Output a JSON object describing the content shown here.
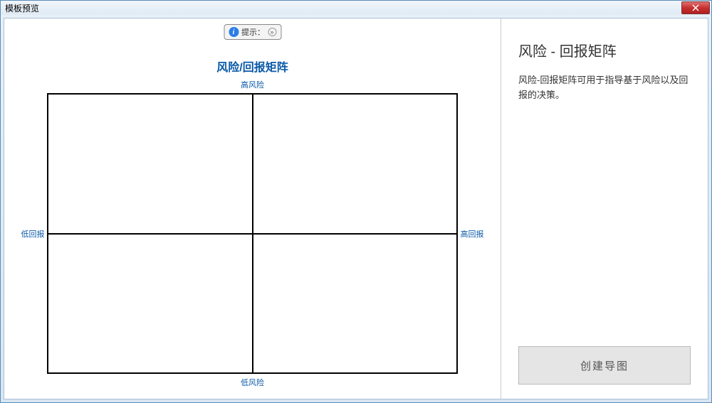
{
  "window": {
    "title": "模板预览"
  },
  "hint": {
    "label": "提示："
  },
  "matrix": {
    "title": "风险/回报矩阵",
    "top": "高风险",
    "bottom": "低风险",
    "left": "低回报",
    "right": "高回报"
  },
  "sidebar": {
    "title": "风险 - 回报矩阵",
    "description": "风险-回报矩阵可用于指导基于风险以及回报的决策。",
    "create_label": "创建导图"
  }
}
